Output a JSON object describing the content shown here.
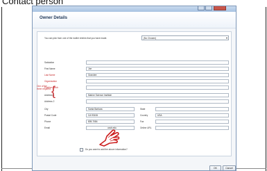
{
  "caption": "Contact person",
  "dialog": {
    "title": "Owner Details",
    "prefill_text": "You can pick from one of the earlier entries that you have made.",
    "prefill_selected": "(No Chosen)",
    "required_note": "One of the three required",
    "fields": {
      "salutation": {
        "label": "Salutation",
        "value": ""
      },
      "first_name": {
        "label": "First Name",
        "value": "Joe"
      },
      "last_name": {
        "label": "Last Name",
        "value": "Grandee"
      },
      "organization": {
        "label": "Organization",
        "value": ""
      },
      "position": {
        "label": "Position Heldr",
        "value": ""
      },
      "address1": {
        "label": "Address 1",
        "value": "Marine Science Institute"
      },
      "address2": {
        "label": "Address 2",
        "value": ""
      },
      "city": {
        "label": "City",
        "value": "Santa Barbara"
      },
      "state": {
        "label": "State",
        "value": ""
      },
      "postal_code": {
        "label": "Postal Code",
        "value": "CA 93106"
      },
      "country": {
        "label": "Country",
        "value": "USA"
      },
      "phone": {
        "label": "Phone",
        "value": "805-7084"
      },
      "fax": {
        "label": "Fax",
        "value": ""
      },
      "email": {
        "label": "Email",
        "value": "ucsb.edu"
      },
      "online_url": {
        "label": "Online URL",
        "value": ""
      }
    },
    "share_label": "Do you want to add the above information?",
    "ok_label": "OK",
    "cancel_label": "Cancel"
  },
  "colors": {
    "required": "#c6282b",
    "titlebar": "#a8c2e2",
    "hand": "#cc1f1f"
  }
}
